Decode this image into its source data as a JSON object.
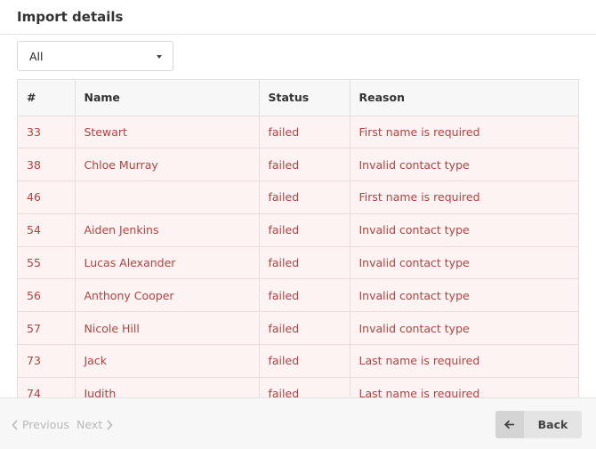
{
  "header": {
    "title": "Import details"
  },
  "filter": {
    "selected": "All"
  },
  "table": {
    "columns": [
      "#",
      "Name",
      "Status",
      "Reason"
    ],
    "rows": [
      [
        "33",
        "Stewart",
        "failed",
        "First name is required"
      ],
      [
        "38",
        "Chloe Murray",
        "failed",
        "Invalid contact type"
      ],
      [
        "46",
        "",
        "failed",
        "First name is required"
      ],
      [
        "54",
        "Aiden Jenkins",
        "failed",
        "Invalid contact type"
      ],
      [
        "55",
        "Lucas Alexander",
        "failed",
        "Invalid contact type"
      ],
      [
        "56",
        "Anthony Cooper",
        "failed",
        "Invalid contact type"
      ],
      [
        "57",
        "Nicole Hill",
        "failed",
        "Invalid contact type"
      ],
      [
        "73",
        "Jack",
        "failed",
        "Last name is required"
      ],
      [
        "74",
        "Judith",
        "failed",
        "Last name is required"
      ]
    ]
  },
  "footer": {
    "previous_label": "Previous",
    "next_label": "Next",
    "back_label": "Back"
  },
  "colors": {
    "failed_text": "#b4423f",
    "failed_row_bg": "#fdf3f3"
  },
  "icons": {
    "previous": "chevron-left-icon",
    "next": "chevron-right-icon",
    "back": "arrow-left-icon",
    "filter": "caret-down-icon"
  }
}
